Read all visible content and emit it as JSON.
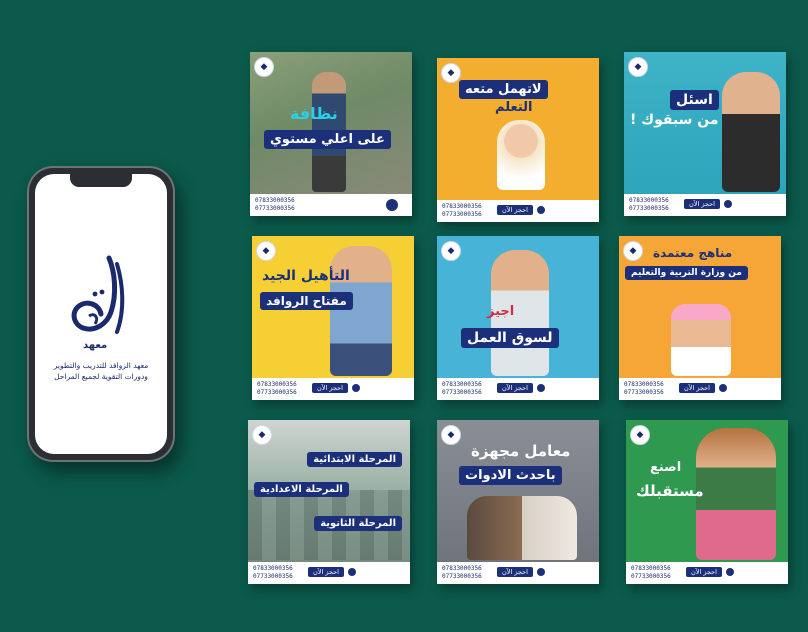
{
  "phone": {
    "logo_word": "معهد",
    "caption_line1": "معهد الروافد للتدريب والتطوير",
    "caption_line2": "ودورات التقوية لجميع المراحل"
  },
  "cards": [
    {
      "headline1": "نظافة",
      "headline2": "على اعلي مستوي"
    },
    {
      "headline1": "لاتهمل متعه",
      "headline2": "التعلم"
    },
    {
      "headline1": "اسئل",
      "headline2": "من سبقوك !"
    },
    {
      "headline1": "التأهيل الجيد",
      "headline2": "مفتاح الروافد"
    },
    {
      "headline1": "اجيز",
      "headline2": "لسوق العمل"
    },
    {
      "headline1": "مناهج معتمدة",
      "headline2": "من وزارة التربية والتعليم"
    },
    {
      "headline1": "المرحلة الابتدائية",
      "headline2": "المرحلة الاعدادية",
      "headline3": "المرحلة الثانوية"
    },
    {
      "headline1": "معامل مجهزة",
      "headline2": "باحدث الادوات"
    },
    {
      "headline1": "اصنع",
      "headline2": "مستقبلك"
    }
  ],
  "footer": {
    "phone1": "07833000356",
    "phone2": "07733000356",
    "book_label": "احجز الآن"
  },
  "colors": {
    "background": "#0b5a4c",
    "brand_blue": "#1c2f7a",
    "accent_orange": "#f5a623",
    "accent_yellow": "#f6c633"
  }
}
